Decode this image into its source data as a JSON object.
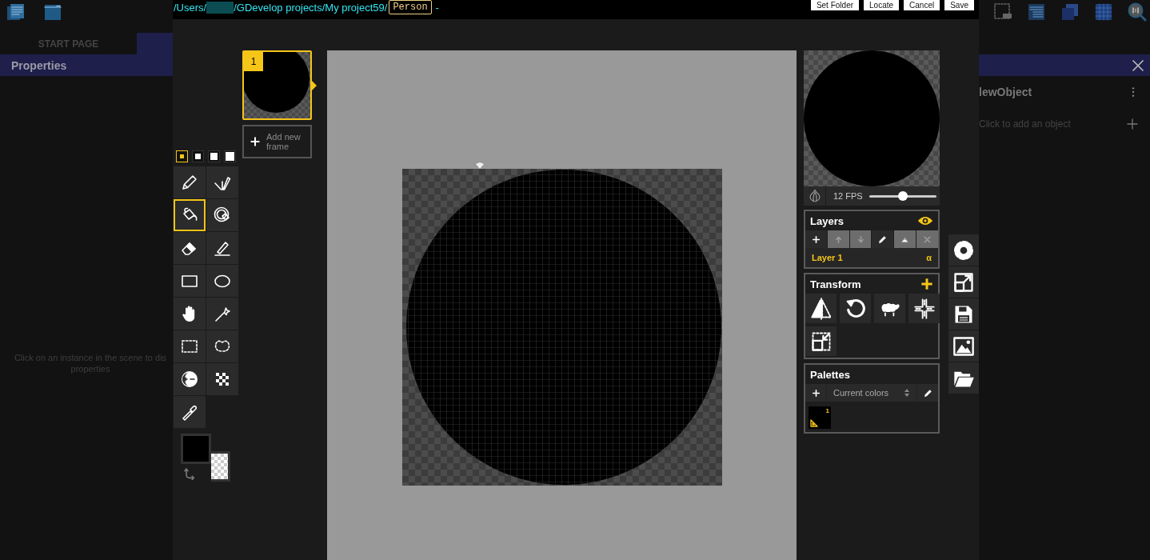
{
  "background_left": {
    "tabs": [
      {
        "label": "START PAGE",
        "selected": false
      },
      {
        "selected": true
      }
    ],
    "panel_title": "Properties",
    "hint_lines": [
      "Click on an instance in the scene to dis",
      "properties"
    ]
  },
  "dialog": {
    "path_start": "/Users/",
    "path_end": "/GDevelop projects/My project59/",
    "name_field": {
      "value": "Person"
    },
    "path_suffix": "-",
    "buttons": [
      "Set Folder",
      "Locate",
      "Cancel",
      "Save"
    ]
  },
  "brush_sizes": [
    {
      "selected": true
    },
    {
      "selected": false
    },
    {
      "selected": false
    },
    {
      "selected": false
    }
  ],
  "tools": [
    {
      "kind": "pencil",
      "selected": false
    },
    {
      "kind": "mirror",
      "selected": false
    },
    {
      "kind": "bucket",
      "selected": true
    },
    {
      "kind": "target",
      "selected": false
    },
    {
      "kind": "eraser",
      "selected": false
    },
    {
      "kind": "line",
      "selected": false
    },
    {
      "kind": "rectangle",
      "selected": false
    },
    {
      "kind": "ellipse",
      "selected": false
    },
    {
      "kind": "hand",
      "selected": false
    },
    {
      "kind": "wand",
      "selected": false
    },
    {
      "kind": "select",
      "selected": false
    },
    {
      "kind": "lasso",
      "selected": false
    },
    {
      "kind": "lighten",
      "selected": false
    },
    {
      "kind": "dither",
      "selected": false
    },
    {
      "kind": "picker",
      "selected": false
    }
  ],
  "colors": {
    "primary": {
      "color": "#000000"
    },
    "secondary": {
      "transparent": true
    }
  },
  "frames": [
    {
      "number": "1",
      "selected": true
    }
  ],
  "add_frame_button": "Add new frame",
  "preview": {
    "fps": "12 FPS",
    "level": 0.5
  },
  "layers": {
    "title": "Layers",
    "buttons": [
      {
        "kind": "add",
        "disabled": false
      },
      {
        "kind": "up",
        "disabled": true
      },
      {
        "kind": "down",
        "disabled": true
      },
      {
        "kind": "edit",
        "disabled": false
      },
      {
        "kind": "merge",
        "disabled": true
      },
      {
        "kind": "delete",
        "disabled": true
      }
    ],
    "items": [
      {
        "name": "Layer 1",
        "alpha": "α",
        "selected": true
      }
    ]
  },
  "transform": {
    "title": "Transform",
    "buttons": [
      {
        "kind": "flip"
      },
      {
        "kind": "rotate"
      },
      {
        "kind": "sheep"
      },
      {
        "kind": "cross"
      },
      {
        "kind": "shrink"
      }
    ]
  },
  "palettes": {
    "title": "Palettes",
    "current": "Current colors",
    "colors": [
      {
        "color": "#000000",
        "count": "1"
      }
    ]
  },
  "side_tools": [
    {
      "kind": "settings"
    },
    {
      "kind": "resize"
    },
    {
      "kind": "save"
    },
    {
      "kind": "image"
    },
    {
      "kind": "folder"
    }
  ],
  "background_right": {
    "object_name": "lewObject",
    "hint": "Click to add an object"
  }
}
